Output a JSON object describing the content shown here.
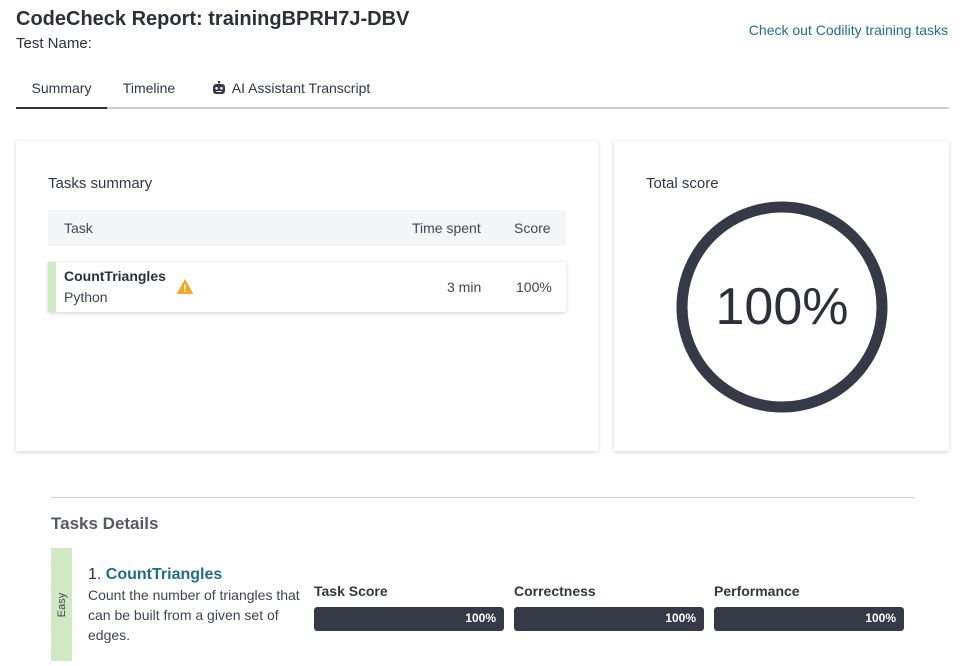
{
  "header": {
    "title": "CodeCheck Report: trainingBPRH7J-DBV",
    "test_name": "Test Name:",
    "training_link": "Check out Codility training tasks"
  },
  "tabs": [
    {
      "label": "Summary",
      "active": true
    },
    {
      "label": "Timeline",
      "active": false
    },
    {
      "label": "AI Assistant Transcript",
      "active": false,
      "icon": "robot-icon"
    }
  ],
  "tasks_summary": {
    "title": "Tasks summary",
    "columns": [
      "Task",
      "Time spent",
      "Score"
    ],
    "rows": [
      {
        "name": "CountTriangles",
        "language": "Python",
        "warning_icon": "warning-icon",
        "time_spent": "3 min",
        "score": "100%"
      }
    ]
  },
  "total_score": {
    "title": "Total score",
    "value": "100%",
    "fraction": 1.0
  },
  "tasks_details": {
    "title": "Tasks Details",
    "tasks": [
      {
        "difficulty": "Easy",
        "number": "1.",
        "name": "CountTriangles",
        "description": "Count the number of triangles that can be built from a given set of edges.",
        "metrics": [
          {
            "label": "Task Score",
            "value": "100%",
            "fraction": 1.0
          },
          {
            "label": "Correctness",
            "value": "100%",
            "fraction": 1.0
          },
          {
            "label": "Performance",
            "value": "100%",
            "fraction": 1.0
          }
        ]
      }
    ]
  },
  "colors": {
    "accent": "#1e6e8c",
    "dark": "#363a46",
    "easy_green": "#cfeac2",
    "warning": "#f5a623"
  }
}
